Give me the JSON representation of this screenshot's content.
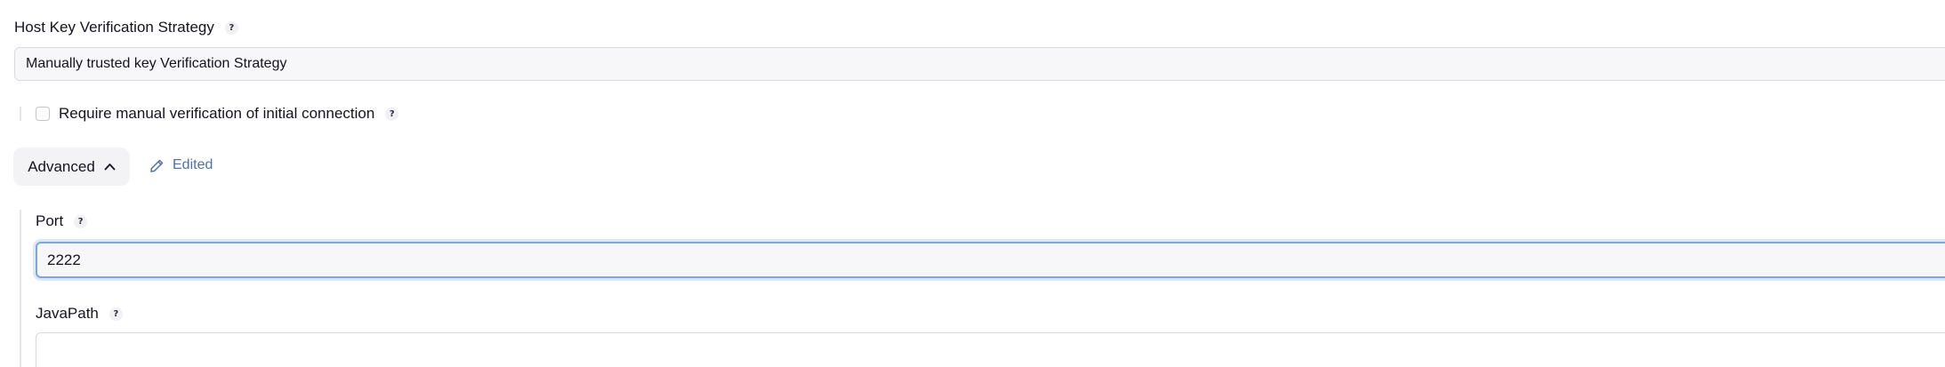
{
  "host_key": {
    "label": "Host Key Verification Strategy",
    "help": "?",
    "selected": "Manually trusted key Verification Strategy"
  },
  "manual_verification": {
    "label": "Require manual verification of initial connection",
    "help": "?",
    "checked": false
  },
  "advanced": {
    "label": "Advanced",
    "edited_label": "Edited"
  },
  "port": {
    "label": "Port",
    "help": "?",
    "value": "2222"
  },
  "java_path": {
    "label": "JavaPath",
    "help": "?",
    "value": ""
  },
  "colors": {
    "accent": "#4f72a8",
    "focus_border": "#7da6dd"
  }
}
